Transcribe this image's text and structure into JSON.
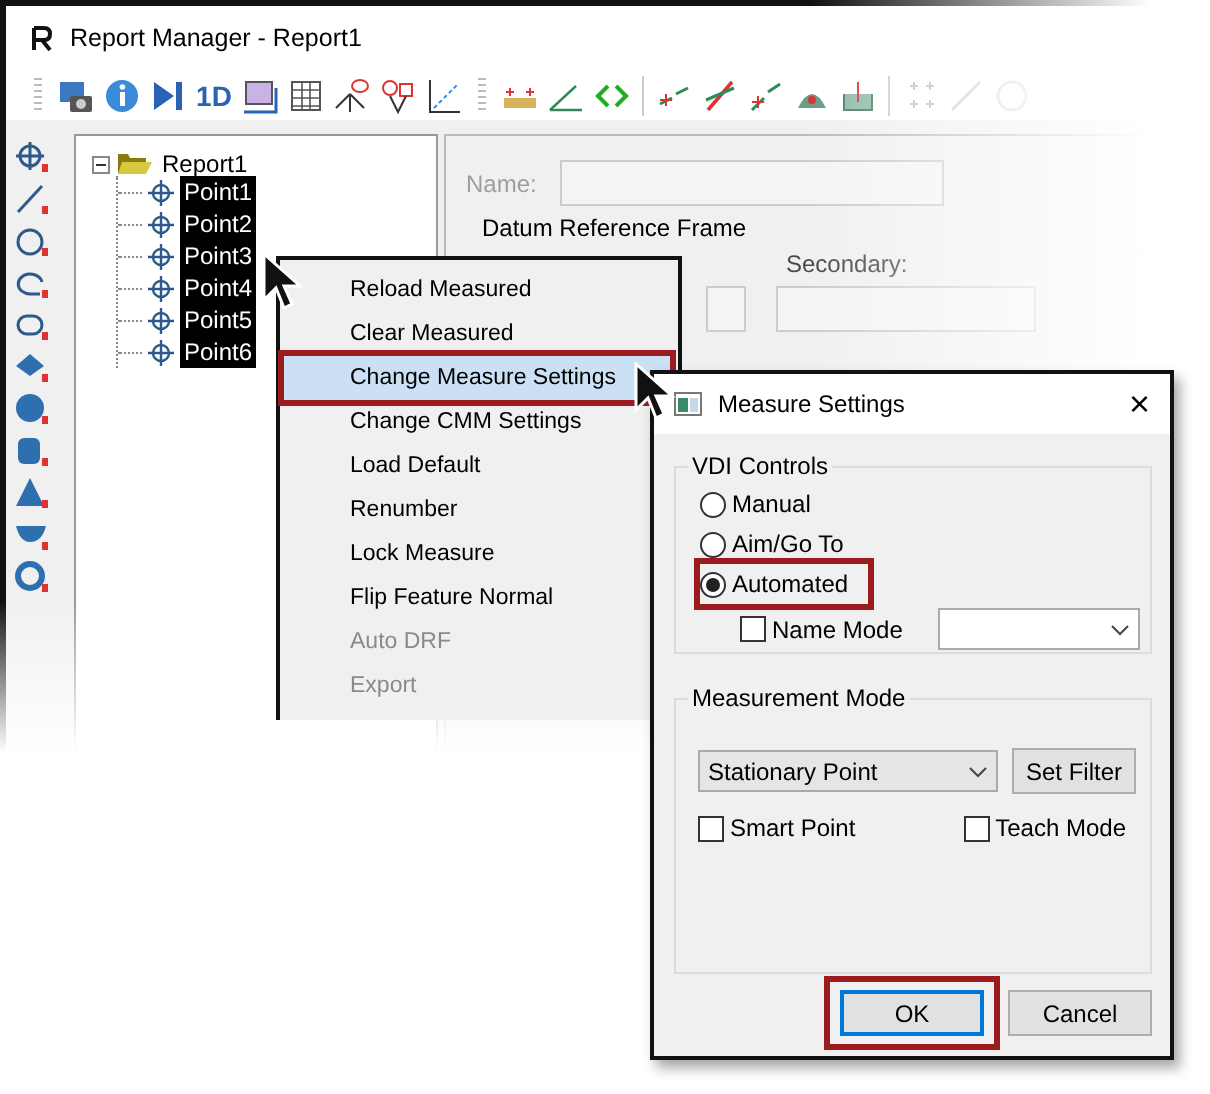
{
  "window": {
    "title": "Report Manager - Report1"
  },
  "toolbar": {
    "text_button": "1D"
  },
  "tree": {
    "label": "Report1",
    "expanded": true,
    "children": [
      {
        "label": "Point1",
        "selected": true
      },
      {
        "label": "Point2",
        "selected": true
      },
      {
        "label": "Point3",
        "selected": true
      },
      {
        "label": "Point4",
        "selected": true
      },
      {
        "label": "Point5",
        "selected": true
      },
      {
        "label": "Point6",
        "selected": true
      }
    ]
  },
  "details": {
    "name_label": "Name:",
    "group_title": "Datum Reference Frame",
    "secondary_label": "Secondary:"
  },
  "context_menu": {
    "items": [
      {
        "label": "Reload Measured",
        "selected": false,
        "disabled": false,
        "callout": false
      },
      {
        "label": "Clear Measured",
        "selected": false,
        "disabled": false,
        "callout": false
      },
      {
        "label": "Change Measure Settings",
        "selected": true,
        "disabled": false,
        "callout": true
      },
      {
        "label": "Change CMM Settings",
        "selected": false,
        "disabled": false,
        "callout": false
      },
      {
        "label": "Load Default",
        "selected": false,
        "disabled": false,
        "callout": false
      },
      {
        "label": "Renumber",
        "selected": false,
        "disabled": false,
        "callout": false
      },
      {
        "label": "Lock Measure",
        "selected": false,
        "disabled": false,
        "callout": false
      },
      {
        "label": "Flip Feature Normal",
        "selected": false,
        "disabled": false,
        "callout": false
      },
      {
        "label": "Auto DRF",
        "selected": false,
        "disabled": true,
        "callout": false
      },
      {
        "label": "Export",
        "selected": false,
        "disabled": true,
        "callout": false
      }
    ]
  },
  "dialog": {
    "title": "Measure Settings",
    "close": "×",
    "vdi_group": "VDI Controls",
    "radios": [
      {
        "label": "Manual",
        "selected": false,
        "callout": false
      },
      {
        "label": "Aim/Go To",
        "selected": false,
        "callout": false
      },
      {
        "label": "Automated",
        "selected": true,
        "callout": true
      }
    ],
    "name_mode": {
      "label": "Name Mode",
      "checked": false
    },
    "mode_group": "Measurement Mode",
    "mode_select": "Stationary Point",
    "set_filter": "Set Filter",
    "checkboxes": [
      {
        "label": "Smart Point",
        "checked": false
      },
      {
        "label": "Teach Mode",
        "checked": false
      }
    ],
    "buttons": [
      {
        "label": "OK",
        "default": true,
        "callout": true
      },
      {
        "label": "Cancel",
        "default": false,
        "callout": false
      }
    ]
  }
}
